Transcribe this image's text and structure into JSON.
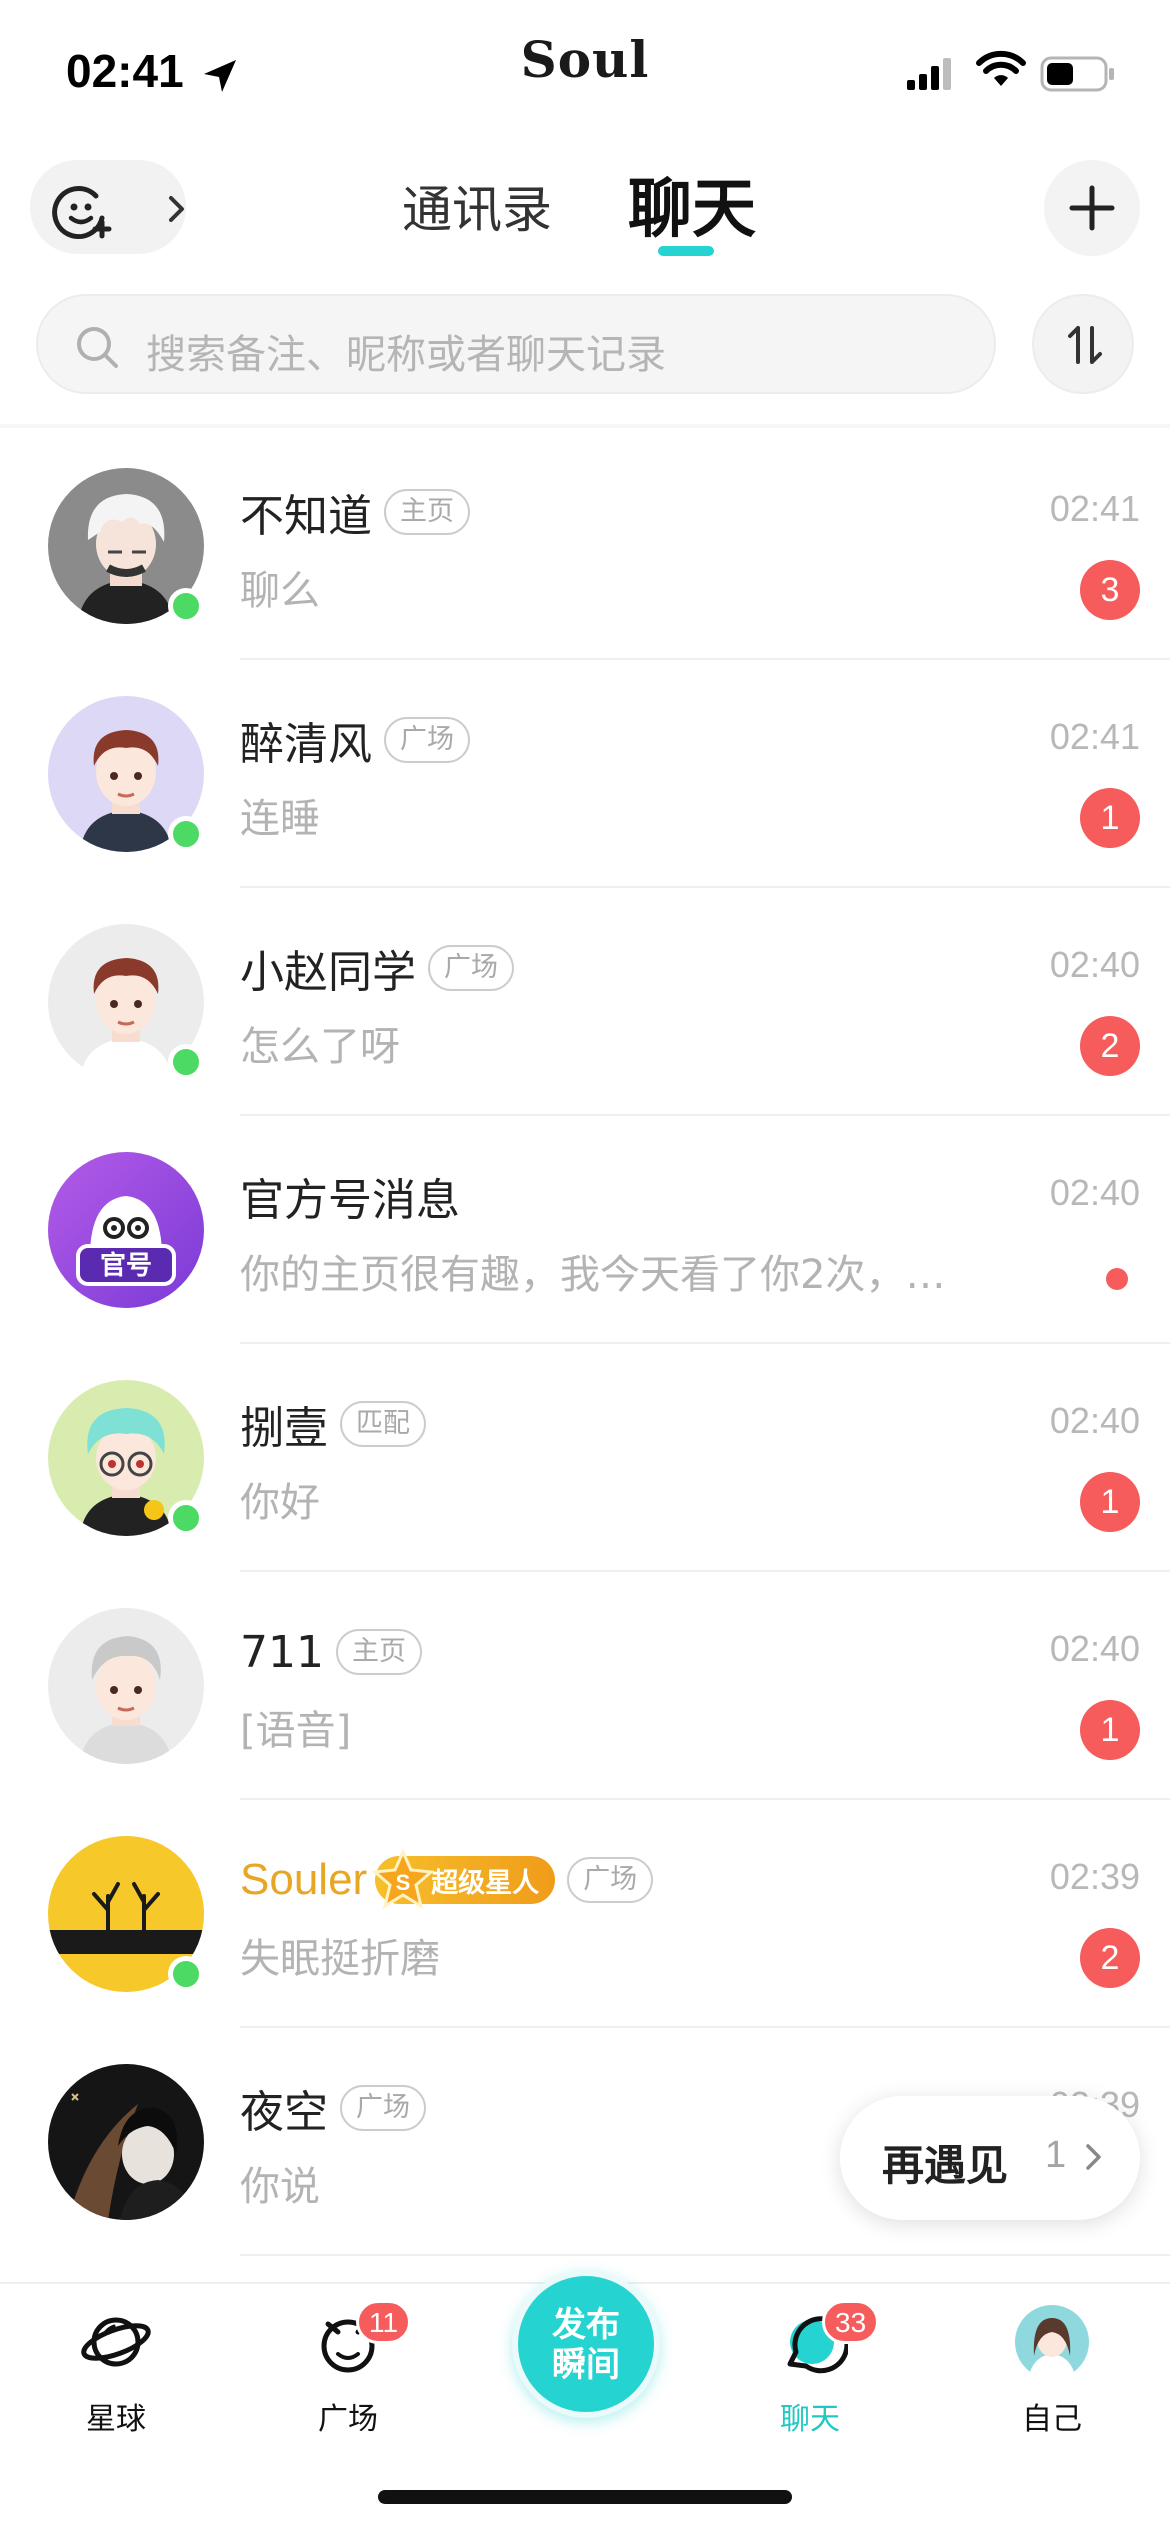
{
  "status_bar": {
    "time": "02:41",
    "brand": "Soul"
  },
  "header": {
    "tabs": [
      {
        "label": "通讯录",
        "active": false
      },
      {
        "label": "聊天",
        "active": true
      }
    ]
  },
  "search": {
    "placeholder": "搜索备注、昵称或者聊天记录"
  },
  "chats": [
    {
      "name": "不知道",
      "tag": "主页",
      "time": "02:41",
      "preview": "聊么",
      "unread": "3",
      "online": true,
      "avatar": "white-hair-boy"
    },
    {
      "name": "醉清风",
      "tag": "广场",
      "time": "02:41",
      "preview": "连睡",
      "unread": "1",
      "online": true,
      "avatar": "brown-hair-boy"
    },
    {
      "name": "小赵同学",
      "tag": "广场",
      "time": "02:40",
      "preview": "怎么了呀",
      "unread": "2",
      "online": true,
      "avatar": "brown-hair-boy-white"
    },
    {
      "name": "官方号消息",
      "tag": "",
      "time": "02:40",
      "preview": "你的主页很有趣，我今天看了你2次，…",
      "unread": "dot",
      "online": false,
      "avatar": "official"
    },
    {
      "name": "捌壹",
      "tag": "匹配",
      "time": "02:40",
      "preview": "你好",
      "unread": "1",
      "online": true,
      "avatar": "mint-hair-glasses"
    },
    {
      "name": "711",
      "tag": "主页",
      "time": "02:40",
      "preview": "[语音]",
      "unread": "1",
      "online": false,
      "avatar": "grey-hair-boy"
    },
    {
      "name": "Souler",
      "badge": "超级星人",
      "tag": "广场",
      "time": "02:39",
      "preview": "失眠挺折磨",
      "unread": "2",
      "online": true,
      "avatar": "antlers-yellow"
    },
    {
      "name": "夜空",
      "tag": "广场",
      "time": "02:39",
      "preview": "你说",
      "unread": "",
      "online": false,
      "avatar": "dark-anime"
    }
  ],
  "meet_again": {
    "label": "再遇见",
    "count": "1"
  },
  "tabbar": {
    "planet": {
      "label": "星球"
    },
    "square": {
      "label": "广场",
      "badge": "11"
    },
    "publish": {
      "line1": "发布",
      "line2": "瞬间"
    },
    "chat": {
      "label": "聊天",
      "badge": "33"
    },
    "me": {
      "label": "自己"
    }
  },
  "colors": {
    "accent": "#25d4d0",
    "badge_red": "#f65c5c",
    "online_green": "#4cd964",
    "gold": "#e7a624"
  }
}
